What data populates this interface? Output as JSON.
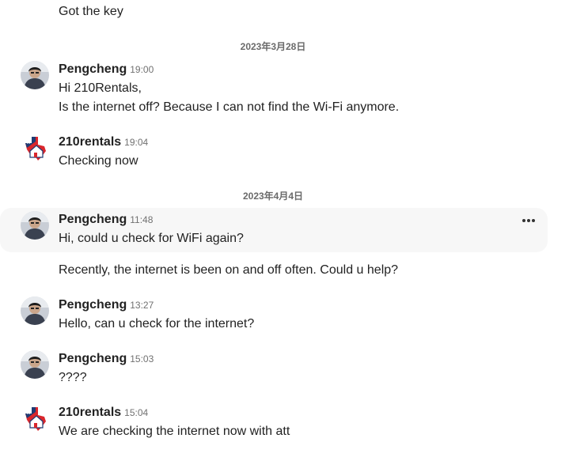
{
  "messages": {
    "m0": {
      "text": "Got the key"
    },
    "d1": "2023年3月28日",
    "m1": {
      "sender": "Pengcheng",
      "time": "19:00",
      "lines": [
        "Hi 210Rentals,",
        "Is the internet off? Because I can not find the Wi-Fi anymore."
      ]
    },
    "m2": {
      "sender": "210rentals",
      "time": "19:04",
      "text": "Checking now"
    },
    "d2": "2023年4月4日",
    "m3": {
      "sender": "Pengcheng",
      "time": "11:48",
      "text": "Hi, could u check for WiFi again?"
    },
    "m3b": {
      "text": "Recently, the internet is been on and off often. Could u help?"
    },
    "m4": {
      "sender": "Pengcheng",
      "time": "13:27",
      "text": "Hello, can u check for the internet?"
    },
    "m5": {
      "sender": "Pengcheng",
      "time": "15:03",
      "text": "????"
    },
    "m6": {
      "sender": "210rentals",
      "time": "15:04",
      "text": "We are checking the internet now with att"
    }
  },
  "icons": {
    "more": "more-horizontal-icon",
    "user_avatar": "user-photo-avatar",
    "host_avatar": "texas-house-logo-avatar"
  },
  "colors": {
    "text": "#222222",
    "muted": "#717171",
    "hover_bg": "#f7f7f7",
    "host_red": "#d9262c",
    "host_navy": "#1f3b73"
  }
}
